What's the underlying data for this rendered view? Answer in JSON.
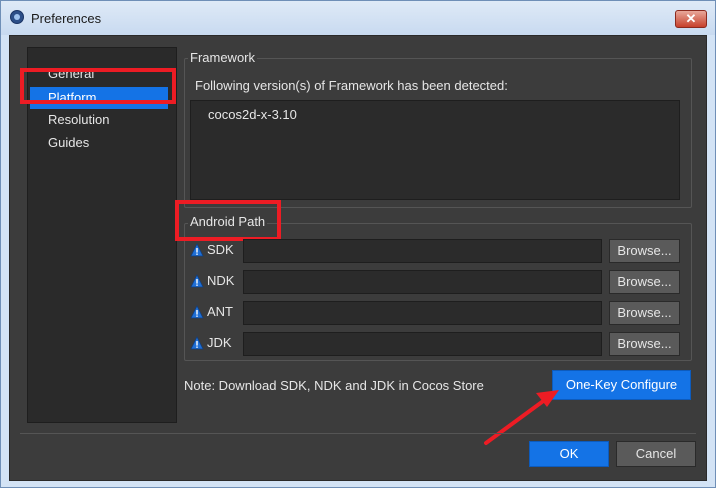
{
  "window": {
    "title": "Preferences",
    "close_glyph": "✕"
  },
  "sidebar": {
    "items": [
      {
        "label": "General"
      },
      {
        "label": "Platform"
      },
      {
        "label": "Resolution"
      },
      {
        "label": "Guides"
      }
    ],
    "selected": "Platform"
  },
  "framework": {
    "title": "Framework",
    "detected_label": "Following version(s) of Framework has been detected:",
    "items": [
      "cocos2d-x-3.10"
    ]
  },
  "android": {
    "title": "Android Path",
    "rows": [
      {
        "label": "SDK",
        "value": "",
        "browse": "Browse..."
      },
      {
        "label": "NDK",
        "value": "",
        "browse": "Browse..."
      },
      {
        "label": "ANT",
        "value": "",
        "browse": "Browse..."
      },
      {
        "label": "JDK",
        "value": "",
        "browse": "Browse..."
      }
    ],
    "row_icon": "warning-icon"
  },
  "note": "Note: Download SDK, NDK and JDK in Cocos Store",
  "one_key_label": "One-Key Configure",
  "footer": {
    "ok_label": "OK",
    "cancel_label": "Cancel"
  },
  "colors": {
    "accent": "#1473e6",
    "highlight": "#ed1c24",
    "panel": "#3c3c3c"
  }
}
